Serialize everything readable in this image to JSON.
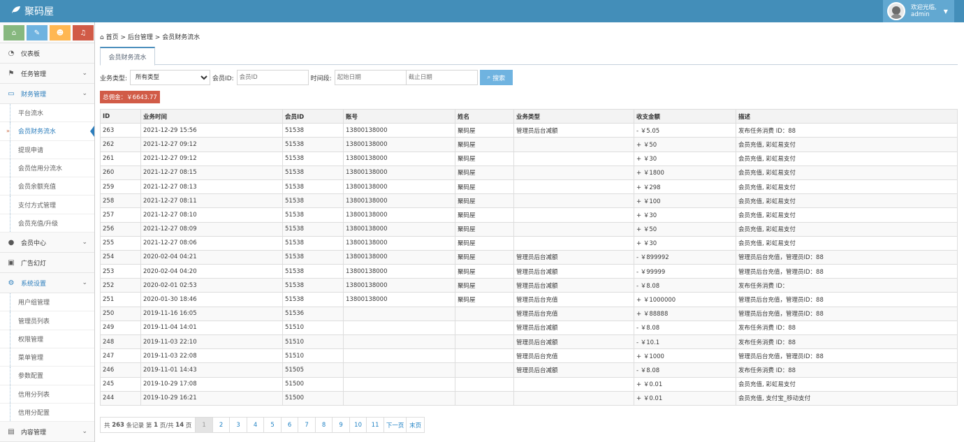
{
  "header": {
    "brand": "聚码屋",
    "welcome": "欢迎光临,",
    "username": "admin"
  },
  "shortcuts": [
    {
      "icon": "home-icon",
      "color": "#87b87f"
    },
    {
      "icon": "pencil-icon",
      "color": "#6fb3e0"
    },
    {
      "icon": "users-icon",
      "color": "#ffb752"
    },
    {
      "icon": "bell-icon",
      "color": "#d15b47"
    }
  ],
  "breadcrumb": {
    "home": "首页",
    "sep1": ">",
    "level2": "后台管理",
    "sep2": ">",
    "current": "会员财务流水"
  },
  "tab": {
    "label": "会员财务流水"
  },
  "filters": {
    "type_label": "业务类型:",
    "type_value": "所有类型",
    "member_label": "会员ID:",
    "member_placeholder": "会员ID",
    "period_label": "时间段:",
    "start_placeholder": "起始日期",
    "end_placeholder": "截止日期",
    "search_label": "搜索"
  },
  "commission": {
    "text": "总佣金：￥6643.77"
  },
  "sidebar": {
    "dashboard": "仪表板",
    "tasks": "任务管理",
    "finance": "财务管理",
    "finance_items": [
      "平台流水",
      "会员财务流水",
      "提现申请",
      "会员信用分流水",
      "会员余额充值",
      "支付方式管理",
      "会员充值/升级"
    ],
    "members": "会员中心",
    "ads": "广告幻灯",
    "settings": "系统设置",
    "settings_items": [
      "用户组管理",
      "管理员列表",
      "权限管理",
      "菜单管理",
      "参数配置",
      "信用分列表",
      "信用分配置"
    ],
    "content": "内容管理"
  },
  "table": {
    "headers": [
      "ID",
      "业务时间",
      "会员ID",
      "账号",
      "姓名",
      "业务类型",
      "收支金额",
      "描述"
    ],
    "rows": [
      [
        "263",
        "2021-12-29 15:56",
        "51538",
        "13800138000",
        "聚码屋",
        "管理员后台减额",
        "- ￥5.05",
        "发布任务消费 ID：88"
      ],
      [
        "262",
        "2021-12-27 09:12",
        "51538",
        "13800138000",
        "聚码屋",
        "",
        "+ ￥50",
        "会员充值, 彩虹易支付"
      ],
      [
        "261",
        "2021-12-27 09:12",
        "51538",
        "13800138000",
        "聚码屋",
        "",
        "+ ￥30",
        "会员充值, 彩虹易支付"
      ],
      [
        "260",
        "2021-12-27 08:15",
        "51538",
        "13800138000",
        "聚码屋",
        "",
        "+ ￥1800",
        "会员充值, 彩虹易支付"
      ],
      [
        "259",
        "2021-12-27 08:13",
        "51538",
        "13800138000",
        "聚码屋",
        "",
        "+ ￥298",
        "会员充值, 彩虹易支付"
      ],
      [
        "258",
        "2021-12-27 08:11",
        "51538",
        "13800138000",
        "聚码屋",
        "",
        "+ ￥100",
        "会员充值, 彩虹易支付"
      ],
      [
        "257",
        "2021-12-27 08:10",
        "51538",
        "13800138000",
        "聚码屋",
        "",
        "+ ￥30",
        "会员充值, 彩虹易支付"
      ],
      [
        "256",
        "2021-12-27 08:09",
        "51538",
        "13800138000",
        "聚码屋",
        "",
        "+ ￥50",
        "会员充值, 彩虹易支付"
      ],
      [
        "255",
        "2021-12-27 08:06",
        "51538",
        "13800138000",
        "聚码屋",
        "",
        "+ ￥30",
        "会员充值, 彩虹易支付"
      ],
      [
        "254",
        "2020-02-04 04:21",
        "51538",
        "13800138000",
        "聚码屋",
        "管理员后台减额",
        "- ￥899992",
        "管理员后台充值，管理员ID：88"
      ],
      [
        "253",
        "2020-02-04 04:20",
        "51538",
        "13800138000",
        "聚码屋",
        "管理员后台减额",
        "- ￥99999",
        "管理员后台充值，管理员ID：88"
      ],
      [
        "252",
        "2020-02-01 02:53",
        "51538",
        "13800138000",
        "聚码屋",
        "管理员后台减额",
        "- ￥8.08",
        "发布任务消费 ID："
      ],
      [
        "251",
        "2020-01-30 18:46",
        "51538",
        "13800138000",
        "聚码屋",
        "管理员后台充值",
        "+ ￥1000000",
        "管理员后台充值，管理员ID：88"
      ],
      [
        "250",
        "2019-11-16 16:05",
        "51536",
        "",
        "",
        "管理员后台充值",
        "+ ￥88888",
        "管理员后台充值，管理员ID：88"
      ],
      [
        "249",
        "2019-11-04 14:01",
        "51510",
        "",
        "",
        "管理员后台减额",
        "- ￥8.08",
        "发布任务消费 ID：88"
      ],
      [
        "248",
        "2019-11-03 22:10",
        "51510",
        "",
        "",
        "管理员后台减额",
        "- ￥10.1",
        "发布任务消费 ID：88"
      ],
      [
        "247",
        "2019-11-03 22:08",
        "51510",
        "",
        "",
        "管理员后台充值",
        "+ ￥1000",
        "管理员后台充值，管理员ID：88"
      ],
      [
        "246",
        "2019-11-01 14:43",
        "51505",
        "",
        "",
        "管理员后台减额",
        "- ￥8.08",
        "发布任务消费 ID：88"
      ],
      [
        "245",
        "2019-10-29 17:08",
        "51500",
        "",
        "",
        "",
        "+ ￥0.01",
        "会员充值, 彩虹易支付"
      ],
      [
        "244",
        "2019-10-29 16:21",
        "51500",
        "",
        "",
        "",
        "+ ￥0.01",
        "会员充值, 支付宝_移动支付"
      ]
    ]
  },
  "pagination": {
    "info_pre": "共",
    "total": "263",
    "info_mid1": "条记录 第",
    "page": "1",
    "info_mid2": "页/共",
    "pages": "14",
    "info_post": "页",
    "links": [
      "1",
      "2",
      "3",
      "4",
      "5",
      "6",
      "7",
      "8",
      "9",
      "10",
      "11",
      "下一页",
      "末页"
    ]
  }
}
